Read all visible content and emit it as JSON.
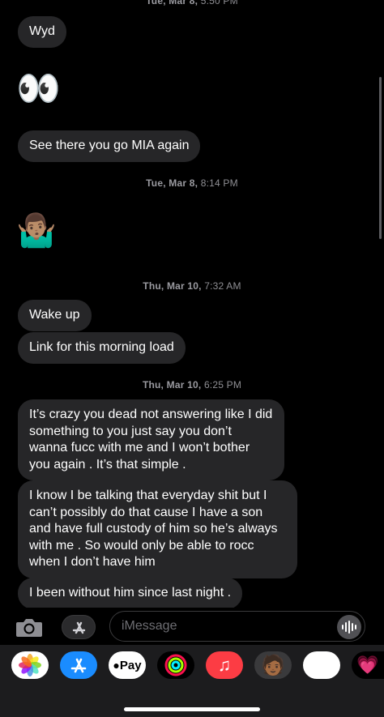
{
  "thread": {
    "stamp0": {
      "day": "Tue, Mar 8,",
      "time": "5:50 PM"
    },
    "bubble_wyd": "Wyd",
    "emoji_eyes": "👀",
    "bubble_mia": "See there you go MIA again",
    "stamp1": {
      "day": "Tue, Mar 8,",
      "time": "8:14 PM"
    },
    "emoji_shrug": "🤷🏽‍♂️",
    "stamp2": {
      "day": "Thu, Mar 10,",
      "time": "7:32 AM"
    },
    "bubble_wake": "Wake up",
    "bubble_link": "Link for this morning load",
    "stamp3": {
      "day": "Thu, Mar 10,",
      "time": "6:25 PM"
    },
    "bubble_crazy": "It’s crazy you dead not answering like I did something to you just say you don’t wanna fucc with me and I won’t bother you again . It’s that simple .",
    "bubble_son": "I know I be talking that everyday shit but I can’t possibly do that cause I have a son and have full custody of him so he’s always with me . So would only be able to rocc when I don’t have him",
    "bubble_without": "I been without him since last night ."
  },
  "input": {
    "placeholder": "iMessage"
  },
  "apps": [
    {
      "name": "photos-app",
      "label": ""
    },
    {
      "name": "app-store-app",
      "label": ""
    },
    {
      "name": "apple-pay-app",
      "label": "Pay"
    },
    {
      "name": "activity-app",
      "label": ""
    },
    {
      "name": "music-app",
      "label": "♫"
    },
    {
      "name": "memoji-app",
      "label": "🧑🏾"
    },
    {
      "name": "memoji-stickers-app",
      "label": "😍"
    },
    {
      "name": "digital-touch-app",
      "label": "💗"
    }
  ],
  "colors": {
    "bubble": "#262628",
    "background": "#000000",
    "drawer": "#1c1c1e"
  }
}
